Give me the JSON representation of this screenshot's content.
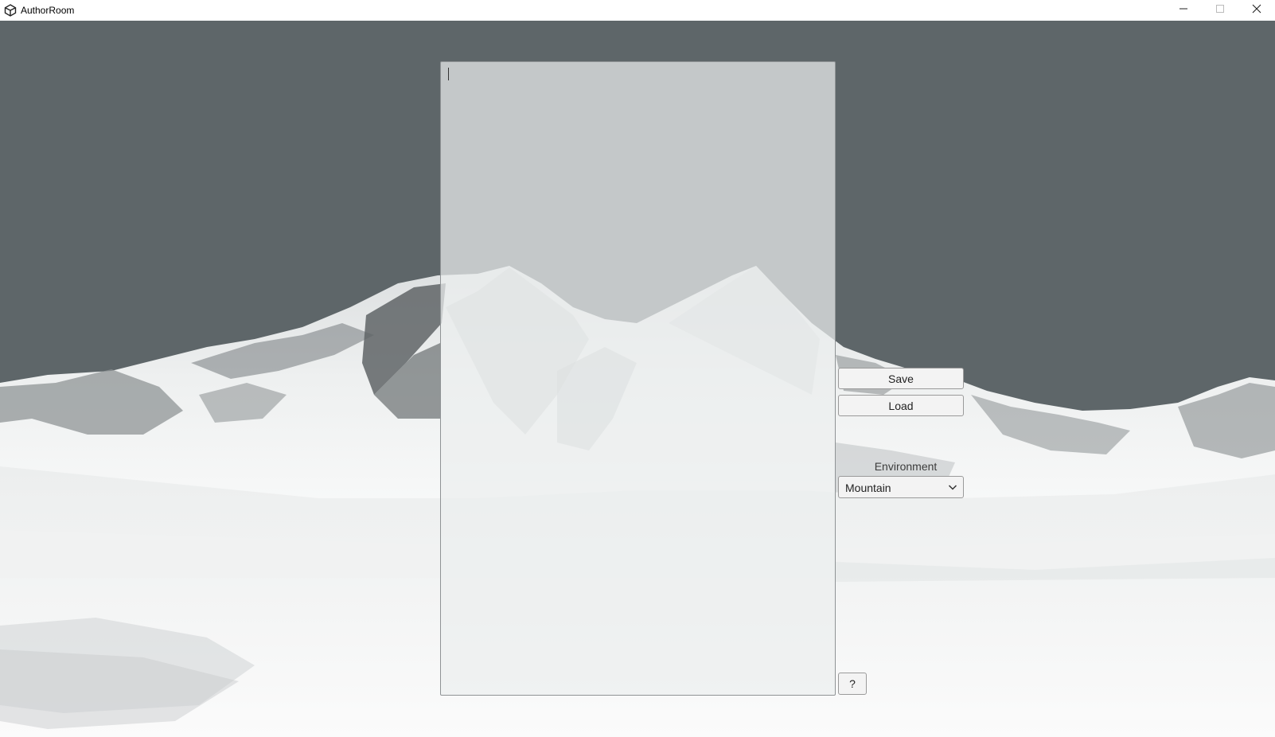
{
  "window": {
    "title": "AuthorRoom",
    "icon": "unity-logo-icon",
    "controls": [
      "minimize-icon",
      "maximize-icon",
      "close-icon"
    ]
  },
  "editor": {
    "text": "",
    "placeholder": ""
  },
  "toolbar": {
    "save_label": "Save",
    "load_label": "Load",
    "help_label": "?"
  },
  "environment": {
    "label": "Environment",
    "selected": "Mountain",
    "icon": "chevron-down-icon"
  },
  "colors": {
    "sky": "#5e6669",
    "snow": "#f4f5f5",
    "panel": "#ebeeee"
  }
}
